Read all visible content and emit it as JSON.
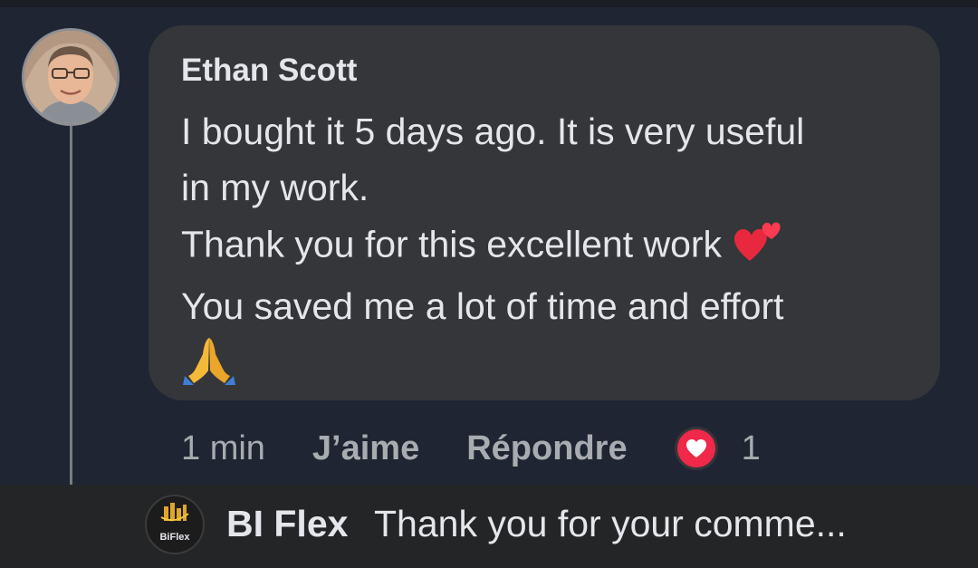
{
  "comment": {
    "author": "Ethan Scott",
    "lines": [
      "I bought it 5 days ago. It is very useful",
      "in my work.",
      "Thank you for this excellent work",
      "You saved me a lot of time and effort"
    ],
    "emojis": [
      "two-hearts-icon",
      "folded-hands-icon"
    ],
    "time": "1 min",
    "like_label": "J’aime",
    "reply_label": "Répondre",
    "reaction_icon": "love-reaction-icon",
    "reaction_count": "1"
  },
  "reply": {
    "logo_text": "BiFlex",
    "author": "BI Flex",
    "preview": "Thank you for your comme..."
  },
  "colors": {
    "background": "#1f2532",
    "bubble": "#35363a",
    "reply_bar": "#242526",
    "text": "#e4e6eb",
    "muted": "#a8abb0",
    "love_reaction": "#f02849"
  }
}
